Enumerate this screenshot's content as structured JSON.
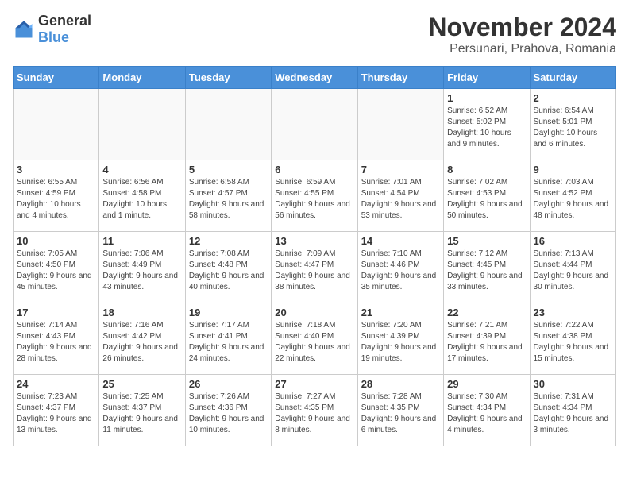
{
  "logo": {
    "general": "General",
    "blue": "Blue"
  },
  "title": "November 2024",
  "location": "Persunari, Prahova, Romania",
  "days_header": [
    "Sunday",
    "Monday",
    "Tuesday",
    "Wednesday",
    "Thursday",
    "Friday",
    "Saturday"
  ],
  "weeks": [
    [
      {
        "day": "",
        "info": ""
      },
      {
        "day": "",
        "info": ""
      },
      {
        "day": "",
        "info": ""
      },
      {
        "day": "",
        "info": ""
      },
      {
        "day": "",
        "info": ""
      },
      {
        "day": "1",
        "info": "Sunrise: 6:52 AM\nSunset: 5:02 PM\nDaylight: 10 hours and 9 minutes."
      },
      {
        "day": "2",
        "info": "Sunrise: 6:54 AM\nSunset: 5:01 PM\nDaylight: 10 hours and 6 minutes."
      }
    ],
    [
      {
        "day": "3",
        "info": "Sunrise: 6:55 AM\nSunset: 4:59 PM\nDaylight: 10 hours and 4 minutes."
      },
      {
        "day": "4",
        "info": "Sunrise: 6:56 AM\nSunset: 4:58 PM\nDaylight: 10 hours and 1 minute."
      },
      {
        "day": "5",
        "info": "Sunrise: 6:58 AM\nSunset: 4:57 PM\nDaylight: 9 hours and 58 minutes."
      },
      {
        "day": "6",
        "info": "Sunrise: 6:59 AM\nSunset: 4:55 PM\nDaylight: 9 hours and 56 minutes."
      },
      {
        "day": "7",
        "info": "Sunrise: 7:01 AM\nSunset: 4:54 PM\nDaylight: 9 hours and 53 minutes."
      },
      {
        "day": "8",
        "info": "Sunrise: 7:02 AM\nSunset: 4:53 PM\nDaylight: 9 hours and 50 minutes."
      },
      {
        "day": "9",
        "info": "Sunrise: 7:03 AM\nSunset: 4:52 PM\nDaylight: 9 hours and 48 minutes."
      }
    ],
    [
      {
        "day": "10",
        "info": "Sunrise: 7:05 AM\nSunset: 4:50 PM\nDaylight: 9 hours and 45 minutes."
      },
      {
        "day": "11",
        "info": "Sunrise: 7:06 AM\nSunset: 4:49 PM\nDaylight: 9 hours and 43 minutes."
      },
      {
        "day": "12",
        "info": "Sunrise: 7:08 AM\nSunset: 4:48 PM\nDaylight: 9 hours and 40 minutes."
      },
      {
        "day": "13",
        "info": "Sunrise: 7:09 AM\nSunset: 4:47 PM\nDaylight: 9 hours and 38 minutes."
      },
      {
        "day": "14",
        "info": "Sunrise: 7:10 AM\nSunset: 4:46 PM\nDaylight: 9 hours and 35 minutes."
      },
      {
        "day": "15",
        "info": "Sunrise: 7:12 AM\nSunset: 4:45 PM\nDaylight: 9 hours and 33 minutes."
      },
      {
        "day": "16",
        "info": "Sunrise: 7:13 AM\nSunset: 4:44 PM\nDaylight: 9 hours and 30 minutes."
      }
    ],
    [
      {
        "day": "17",
        "info": "Sunrise: 7:14 AM\nSunset: 4:43 PM\nDaylight: 9 hours and 28 minutes."
      },
      {
        "day": "18",
        "info": "Sunrise: 7:16 AM\nSunset: 4:42 PM\nDaylight: 9 hours and 26 minutes."
      },
      {
        "day": "19",
        "info": "Sunrise: 7:17 AM\nSunset: 4:41 PM\nDaylight: 9 hours and 24 minutes."
      },
      {
        "day": "20",
        "info": "Sunrise: 7:18 AM\nSunset: 4:40 PM\nDaylight: 9 hours and 22 minutes."
      },
      {
        "day": "21",
        "info": "Sunrise: 7:20 AM\nSunset: 4:39 PM\nDaylight: 9 hours and 19 minutes."
      },
      {
        "day": "22",
        "info": "Sunrise: 7:21 AM\nSunset: 4:39 PM\nDaylight: 9 hours and 17 minutes."
      },
      {
        "day": "23",
        "info": "Sunrise: 7:22 AM\nSunset: 4:38 PM\nDaylight: 9 hours and 15 minutes."
      }
    ],
    [
      {
        "day": "24",
        "info": "Sunrise: 7:23 AM\nSunset: 4:37 PM\nDaylight: 9 hours and 13 minutes."
      },
      {
        "day": "25",
        "info": "Sunrise: 7:25 AM\nSunset: 4:37 PM\nDaylight: 9 hours and 11 minutes."
      },
      {
        "day": "26",
        "info": "Sunrise: 7:26 AM\nSunset: 4:36 PM\nDaylight: 9 hours and 10 minutes."
      },
      {
        "day": "27",
        "info": "Sunrise: 7:27 AM\nSunset: 4:35 PM\nDaylight: 9 hours and 8 minutes."
      },
      {
        "day": "28",
        "info": "Sunrise: 7:28 AM\nSunset: 4:35 PM\nDaylight: 9 hours and 6 minutes."
      },
      {
        "day": "29",
        "info": "Sunrise: 7:30 AM\nSunset: 4:34 PM\nDaylight: 9 hours and 4 minutes."
      },
      {
        "day": "30",
        "info": "Sunrise: 7:31 AM\nSunset: 4:34 PM\nDaylight: 9 hours and 3 minutes."
      }
    ]
  ]
}
